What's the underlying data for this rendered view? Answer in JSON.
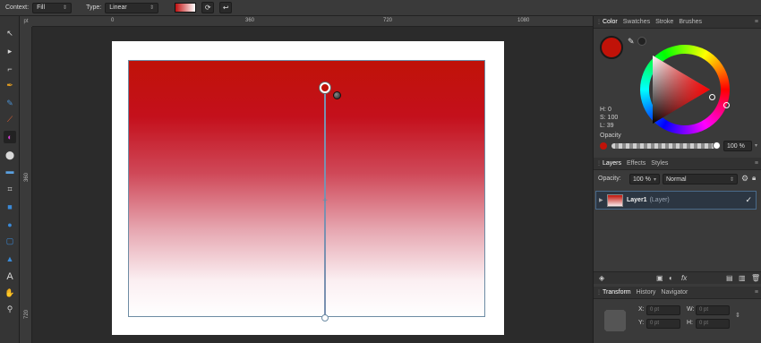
{
  "context_toolbar": {
    "context_label": "Context:",
    "context_value": "Fill",
    "type_label": "Type:",
    "type_value": "Linear"
  },
  "ruler": {
    "unit": "pt",
    "h_ticks": [
      "0",
      "360",
      "720",
      "1080"
    ],
    "v_ticks": [
      "360",
      "720"
    ]
  },
  "color_panel": {
    "tabs": [
      "Color",
      "Swatches",
      "Stroke",
      "Brushes"
    ],
    "active_tab": "Color",
    "current_color": "#c01208",
    "h": "H: 0",
    "s": "S: 100",
    "l": "L: 39",
    "opacity_label": "Opacity",
    "opacity_value": "100 %",
    "opacity_level": 1.0
  },
  "layers_panel": {
    "tabs": [
      "Layers",
      "Effects",
      "Styles"
    ],
    "active_tab": "Layers",
    "opacity_label": "Opacity:",
    "opacity_value": "100 %",
    "blend_mode": "Normal",
    "layers": [
      {
        "name": "Layer1",
        "kind": "(Layer)",
        "visible": true
      }
    ]
  },
  "transform_panel": {
    "tabs": [
      "Transform",
      "History",
      "Navigator"
    ],
    "active_tab": "Transform",
    "x_label": "X:",
    "x_value": "0 pt",
    "y_label": "Y:",
    "y_value": "0 pt",
    "w_label": "W:",
    "w_value": "0 pt",
    "h_label": "H:",
    "h_value": "0 pt"
  },
  "canvas": {
    "gradient_colors": [
      "#c01208",
      "#ffffff"
    ]
  }
}
